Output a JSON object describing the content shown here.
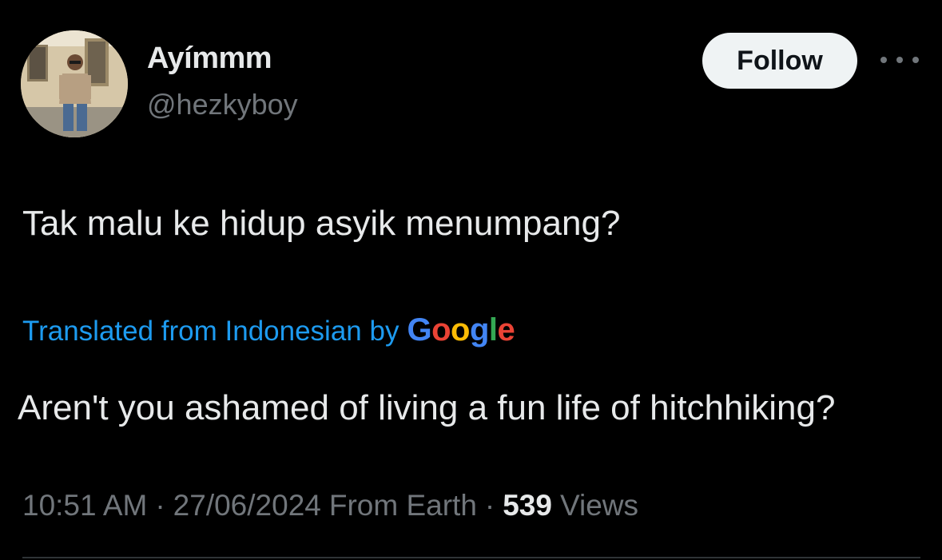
{
  "author": {
    "display_name": "Ayímmm",
    "handle": "@hezkyboy"
  },
  "actions": {
    "follow_label": "Follow",
    "more_icon": "more-horizontal-icon"
  },
  "tweet": {
    "text": "Tak malu ke hidup asyik menumpang?",
    "translation": {
      "label": "Translated from Indonesian by",
      "provider": {
        "G": "G",
        "o1": "o",
        "o2": "o",
        "g": "g",
        "l": "l",
        "e": "e"
      },
      "text": "Aren't you ashamed of living a fun life of hitchhiking?"
    }
  },
  "meta": {
    "time": "10:51 AM",
    "separator": "·",
    "date": "27/06/2024",
    "source": "From Earth",
    "views_count": "539",
    "views_label": "Views"
  },
  "colors": {
    "background": "#000000",
    "text": "#e7e9ea",
    "muted": "#71767b",
    "link": "#1d9bf0",
    "follow_bg": "#eff3f4"
  }
}
